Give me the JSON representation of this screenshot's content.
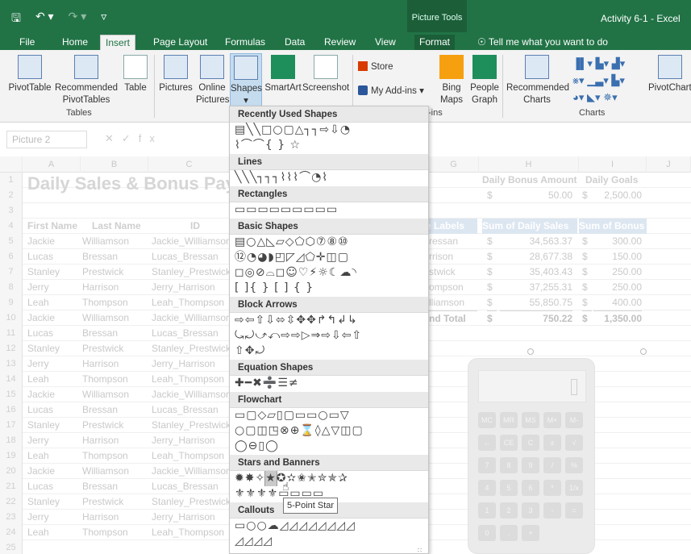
{
  "title_bar": {
    "save_icon": "save-icon",
    "undo_icon": "undo-icon",
    "redo_icon": "redo-icon",
    "customize_icon": "customize-qat-icon",
    "context_label": "Picture Tools",
    "doc_title": "Activity 6-1 - Excel"
  },
  "tabs": [
    "File",
    "Home",
    "Insert",
    "Page Layout",
    "Formulas",
    "Data",
    "Review",
    "View",
    "Format"
  ],
  "active_tab": "Insert",
  "tell_me": "Tell me what you want to do",
  "ribbon": {
    "pivottable": "PivotTable",
    "recommended_pivottables": "Recommended PivotTables",
    "table": "Table",
    "tables_group": "Tables",
    "pictures": "Pictures",
    "online_pictures": "Online Pictures",
    "shapes": "Shapes",
    "smartart": "SmartArt",
    "screenshot": "Screenshot",
    "store": "Store",
    "my_addins": "My Add-ins",
    "bing_maps": "Bing Maps",
    "people_graph": "People Graph",
    "addins_group": "-ins",
    "recommended_charts": "Recommended Charts",
    "charts_group": "Charts",
    "pivotchart": "PivotChart"
  },
  "formula_bar": {
    "name_box": "Picture 2",
    "fx": "fx"
  },
  "sheet": {
    "columns": [
      "A",
      "B",
      "C",
      "G",
      "H",
      "I",
      "J"
    ],
    "title": "Daily Sales & Bonus Pay",
    "headers": [
      "First Name",
      "Last Name",
      "ID"
    ],
    "rows": [
      [
        "Jackie",
        "Williamson",
        "Jackie_Williamson"
      ],
      [
        "Lucas",
        "Bressan",
        "Lucas_Bressan"
      ],
      [
        "Stanley",
        "Prestwick",
        "Stanley_Prestwick"
      ],
      [
        "Jerry",
        "Harrison",
        "Jerry_Harrison"
      ],
      [
        "Leah",
        "Thompson",
        "Leah_Thompson"
      ],
      [
        "Jackie",
        "Williamson",
        "Jackie_Williamson"
      ],
      [
        "Lucas",
        "Bressan",
        "Lucas_Bressan"
      ],
      [
        "Stanley",
        "Prestwick",
        "Stanley_Prestwick"
      ],
      [
        "Jerry",
        "Harrison",
        "Jerry_Harrison"
      ],
      [
        "Leah",
        "Thompson",
        "Leah_Thompson"
      ],
      [
        "Jackie",
        "Williamson",
        "Jackie_Williamson"
      ],
      [
        "Lucas",
        "Bressan",
        "Lucas_Bressan"
      ],
      [
        "Stanley",
        "Prestwick",
        "Stanley_Prestwick"
      ],
      [
        "Jerry",
        "Harrison",
        "Jerry_Harrison"
      ],
      [
        "Leah",
        "Thompson",
        "Leah_Thompson"
      ],
      [
        "Jackie",
        "Williamson",
        "Jackie_Williamson"
      ],
      [
        "Lucas",
        "Bressan",
        "Lucas_Bressan"
      ],
      [
        "Stanley",
        "Prestwick",
        "Stanley_Prestwick"
      ],
      [
        "Jerry",
        "Harrison",
        "Jerry_Harrison"
      ],
      [
        "Leah",
        "Thompson",
        "Leah_Thompson"
      ]
    ],
    "daily_bonus_amount_label": "Daily Bonus Amount",
    "daily_goals_label": "Daily Goals",
    "bonus_value": "50.00",
    "goals_value": "2,500.00",
    "currency": "$",
    "pivot": {
      "row_labels": "e Labels",
      "sum_daily_sales": "Sum of Daily Sales",
      "sum_bonus": "Sum of Bonus",
      "rows": [
        [
          "ressan",
          "34,563.37",
          "300.00"
        ],
        [
          "rrison",
          "28,677.38",
          "150.00"
        ],
        [
          "stwick",
          "35,403.43",
          "250.00"
        ],
        [
          "ompson",
          "37,255.31",
          "250.00"
        ],
        [
          "lliamson",
          "55,850.75",
          "400.00"
        ]
      ],
      "total_label": "nd Total",
      "total_sales": "750.22",
      "total_bonus": "1,350.00"
    }
  },
  "calculator_keys": [
    "MC",
    "MR",
    "MS",
    "M+",
    "M-",
    "←",
    "CE",
    "C",
    "±",
    "√",
    "7",
    "8",
    "9",
    "/",
    "%",
    "4",
    "5",
    "6",
    "*",
    "1/x",
    "1",
    "2",
    "3",
    "-",
    "=",
    "0",
    ".",
    "+"
  ],
  "gallery": {
    "sections": [
      {
        "title": "Recently Used Shapes",
        "rows": [
          "▤╲╲□○▢△┐┐⇨⇩◔",
          "⌇⌒⌒{ } ☆"
        ]
      },
      {
        "title": "Lines",
        "rows": [
          "╲╲╲┐┐┐⌇⌇⌇⌒◔⌇"
        ]
      },
      {
        "title": "Rectangles",
        "rows": [
          "▭▭▭▭▭▭▭▭▭"
        ]
      },
      {
        "title": "Basic Shapes",
        "rows": [
          "▤○△◺▱◇⬠⬡⑦⑧⑩",
          "⑫◔◕◗◰◸◿⬠✛◫▢",
          "◻◎⊘⌓◻☺♡⚡☼☾☁◝",
          "[ ]{ } [ ] { }"
        ]
      },
      {
        "title": "Block Arrows",
        "rows": [
          "⇨⇦⇧⇩⬄⇳✥✥↱↰↲↳",
          "⤿⤾⤻⤺⇨⇨▷⇒⇨⇩⇦⇧",
          "⇧✥⤾"
        ]
      },
      {
        "title": "Equation Shapes",
        "rows": [
          "✚━✖➗☰≠"
        ]
      },
      {
        "title": "Flowchart",
        "rows": [
          "▭▢◇▱▯▢▭▭○▭▽",
          "○▢◫◳⊗⊕⌛◊△▽◫▢",
          "◯⊖▯◯"
        ]
      },
      {
        "title": "Stars and Banners",
        "rows": [
          "✹✸✧★✪✫✬✭✮✯✰",
          "⚜⚜⚜⚜▭▭▭▭"
        ]
      },
      {
        "title": "Callouts",
        "rows": [
          "▭○○☁◿◿◿◿◿◿◿◿",
          "◿◿◿◿"
        ]
      }
    ],
    "hover_shape": "★",
    "tooltip": "5-Point Star"
  }
}
